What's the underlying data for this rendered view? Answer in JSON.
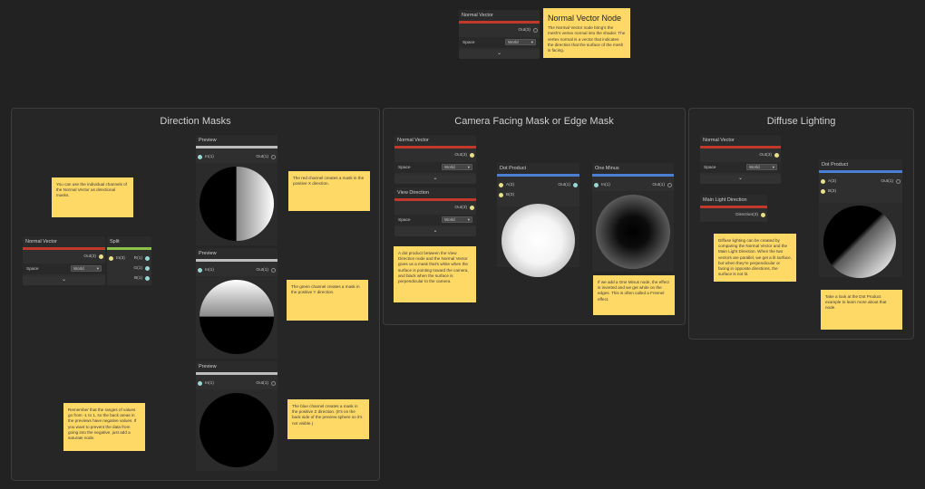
{
  "groups": {
    "direction_masks": "Direction Masks",
    "camera_facing": "Camera Facing Mask or Edge Mask",
    "diffuse_lighting": "Diffuse Lighting"
  },
  "top_node": {
    "title": "Normal Vector",
    "out": "Out(3)",
    "space_label": "Space",
    "space_value": "World"
  },
  "top_sticky": {
    "title": "Normal Vector Node",
    "text": "The Normal Vector node bring's the mesh's vertex normal into the shader. The vertex normal is a vector that indicates the direction that the surface of the mesh is facing."
  },
  "direction": {
    "normal_vector": {
      "title": "Normal Vector",
      "out": "Out(3)",
      "space_label": "Space",
      "space_value": "World"
    },
    "split": {
      "title": "Split",
      "in": "In(3)",
      "r": "R(1)",
      "g": "G(1)",
      "b": "B(1)"
    },
    "preview1": {
      "title": "Preview",
      "in": "In(1)",
      "out": "Out(1)"
    },
    "preview2": {
      "title": "Preview",
      "in": "In(1)",
      "out": "Out(1)"
    },
    "preview3": {
      "title": "Preview",
      "in": "In(1)",
      "out": "Out(1)"
    },
    "sticky_intro": "You can use the individual channels of the Normal Vector as directional masks.",
    "sticky_red": "The red channel creates a mask in the positive X direction.",
    "sticky_green": "The green channel creates a mask in the positive Y direction.",
    "sticky_blue": "The blue channel creates a mask in the positive Z direction. (It's on the back side of the preview sphere so it's not visible.)",
    "sticky_ranges": "Remember that the ranges of values go from -1 to 1, so the back areas in the previews have negative values. If you want to prevent the data from going into the negative, just add a saturate node."
  },
  "camera": {
    "normal_vector": {
      "title": "Normal Vector",
      "out": "Out(3)",
      "space_label": "Space",
      "space_value": "World"
    },
    "view_direction": {
      "title": "View Direction",
      "out": "Out(3)",
      "space_label": "Space",
      "space_value": "World"
    },
    "dot_product": {
      "title": "Dot Product",
      "a": "A(3)",
      "b": "B(3)",
      "out": "Out(1)"
    },
    "one_minus": {
      "title": "One Minus",
      "in": "In(1)",
      "out": "Out(1)"
    },
    "sticky_dot": "A dot product between the View Direction node and the Normal Vector gives us a mask that's white when the surface is pointing toward the camera, and black when the surface is perpendicular to the camera.",
    "sticky_one_minus": "If we add a One Minus node, the effect is inverted and we get white on the edges. This is often called a Fresnel effect."
  },
  "diffuse": {
    "normal_vector": {
      "title": "Normal Vector",
      "out": "Out(3)",
      "space_label": "Space",
      "space_value": "World"
    },
    "main_light": {
      "title": "Main Light Direction",
      "out": "Direction(3)"
    },
    "dot_product": {
      "title": "Dot Product",
      "a": "A(3)",
      "b": "B(3)",
      "out": "Out(1)"
    },
    "sticky_diffuse": "Diffuse lighting can be created by comparing the Normal Vector and the Main Light Direction. When the two vectors are parallel, we get a lit surface, but when they're perpendicular or facing in opposite directions, the surface is not lit.",
    "sticky_more": "Take a look at the Dot Product example to learn more about that node."
  },
  "colors": {
    "vector3_bar": "#c0392b",
    "split_bar": "#8bc34a",
    "float_bar": "#bdbdbd",
    "dot_bar": "#4a7fd4",
    "sticky": "#ffd966",
    "wire_teal": "#9ad7d3",
    "wire_yellow": "#e7e08a"
  }
}
